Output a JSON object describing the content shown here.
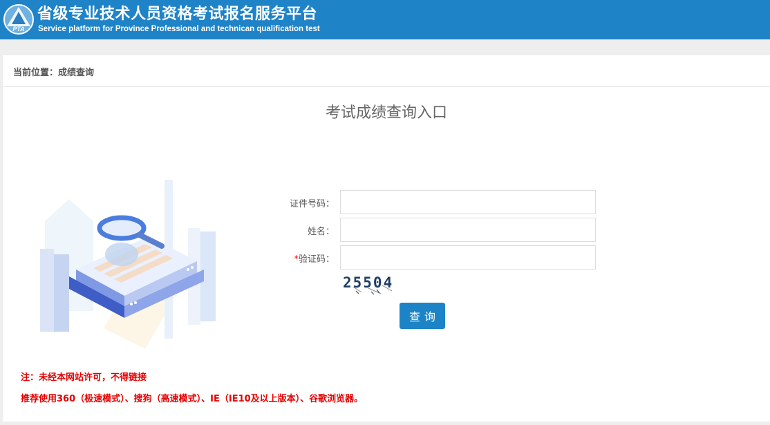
{
  "header": {
    "logo_text": "PTA",
    "title": "省级专业技术人员资格考试报名服务平台",
    "subtitle": "Service platform for Province Professional and technican qualification test"
  },
  "breadcrumb": {
    "text": "当前位置：成绩查询"
  },
  "main": {
    "title": "考试成绩查询入口",
    "form": {
      "id_label": "证件号码：",
      "id_value": "",
      "name_label": "姓名：",
      "name_value": "",
      "captcha_required_mark": "*",
      "captcha_label": "验证码：",
      "captcha_value": "",
      "captcha_image_text": "25504",
      "submit_label": "查询"
    },
    "notes": {
      "line1": "注：未经本网站许可，不得链接",
      "line2": "推荐使用360（极速模式）、搜狗（高速模式）、IE（IE10及以上版本）、谷歌浏览器。"
    }
  },
  "colors": {
    "header_bg": "#1f83c8",
    "button_bg": "#1c83c6",
    "note_text": "#e60000"
  }
}
